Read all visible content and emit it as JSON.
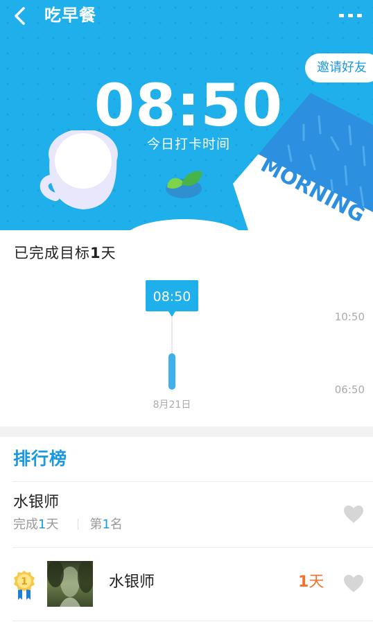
{
  "header": {
    "title": "吃早餐",
    "more_icon": "more-dots-icon",
    "back_icon": "back-chevron-icon"
  },
  "hero": {
    "invite_label": "邀请好友",
    "time": "08:50",
    "time_label": "今日打卡时间",
    "card_text": "MORNING",
    "colors": {
      "background": "#1fb0ec",
      "card": "#2d8fe0",
      "leaf": "#46b44b"
    }
  },
  "progress": {
    "goal_prefix": "已完成目标",
    "goal_days": "1",
    "goal_suffix": "天",
    "tooltip": "08:50",
    "y_top_label": "10:50",
    "y_bottom_label": "06:50",
    "date_label": "8月21日"
  },
  "chart_data": {
    "type": "bar",
    "title": "",
    "categories": [
      "8月21日"
    ],
    "values": [
      "08:50"
    ],
    "ylim": [
      "06:50",
      "10:50"
    ],
    "xlabel": "",
    "ylabel": "",
    "grid": false
  },
  "ranking": {
    "title": "排行榜",
    "me": {
      "name": "水银师",
      "done_prefix": "完成",
      "done_days": "1",
      "done_suffix": "天",
      "rank_prefix": "第",
      "rank": "1",
      "rank_suffix": "名",
      "heart_icon": "heart-icon"
    },
    "rows": [
      {
        "rank": "1",
        "medal_icon": "gold-medal-icon",
        "name": "水银师",
        "days": "1",
        "days_unit": "天",
        "heart_icon": "heart-icon"
      }
    ]
  },
  "colors": {
    "accent": "#1a99e0",
    "highlight": "#f2712c",
    "muted": "#999999",
    "heart": "#d6d6d6"
  }
}
